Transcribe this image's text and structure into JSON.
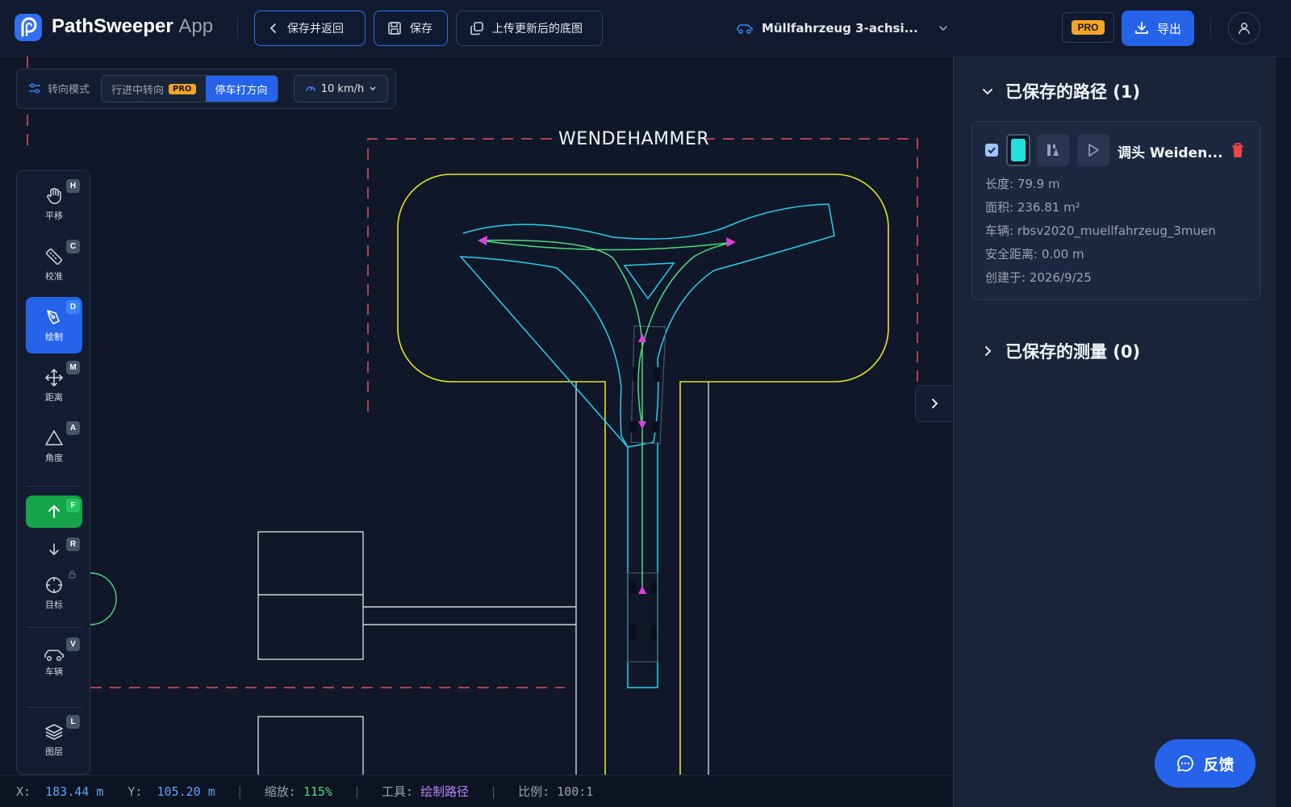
{
  "header": {
    "app_name": "PathSweeper",
    "app_suffix": "App",
    "back_label": "保存并返回",
    "save_label": "保存",
    "upload_label": "上传更新后的底图",
    "vehicle_label": "Müllfahrzeug 3-achsi...",
    "pro_label": "PRO",
    "export_label": "导出"
  },
  "modebar": {
    "label": "转向模式",
    "option_drive": "行进中转向",
    "option_drive_badge": "PRO",
    "option_park": "停车打方向",
    "speed": "10 km/h"
  },
  "tools": [
    {
      "label": "平移",
      "key": "H",
      "icon": "hand-icon"
    },
    {
      "label": "校准",
      "key": "C",
      "icon": "ruler-icon"
    },
    {
      "label": "绘制",
      "key": "D",
      "icon": "pen-icon"
    },
    {
      "label": "距离",
      "key": "M",
      "icon": "move-icon"
    },
    {
      "label": "角度",
      "key": "A",
      "icon": "triangle-icon"
    },
    {
      "label": "",
      "key": "F",
      "icon": "arrow-up-icon"
    },
    {
      "label": "",
      "key": "R",
      "icon": "arrow-down-icon"
    },
    {
      "label": "目标",
      "key": "",
      "icon": "crosshair-icon"
    },
    {
      "label": "车辆",
      "key": "V",
      "icon": "car-icon"
    },
    {
      "label": "图层",
      "key": "L",
      "icon": "layers-icon"
    }
  ],
  "canvas": {
    "area_label": "WENDEHAMMER"
  },
  "status": {
    "x_label": "X:",
    "x_value": "183.44 m",
    "y_label": "Y:",
    "y_value": "105.20 m",
    "zoom_label": "缩放:",
    "zoom_value": "115%",
    "tool_label": "工具:",
    "tool_value": "绘制路径",
    "scale_label": "比例:",
    "scale_value": "100:1"
  },
  "panel": {
    "routes_title": "已保存的路径 (1)",
    "measure_title": "已保存的测量 (0)",
    "route": {
      "name": "调头 Weiden...",
      "length": "长度: 79.9 m",
      "area": "面积: 236.81 m²",
      "vehicle": "车辆: rbsv2020_muellfahrzeug_3muen",
      "safety": "安全距离: 0.00 m",
      "created": "创建于: 2026/9/25",
      "color": "#22e0e0",
      "checked": true
    }
  },
  "feedback_label": "反馈",
  "colors": {
    "accent": "#2563eb",
    "route_cyan": "#22d3ee",
    "path_green": "#4ade80",
    "arrow_magenta": "#e040e0",
    "boundary_yellow": "#e5e51f",
    "dashed_red": "#e05560"
  }
}
